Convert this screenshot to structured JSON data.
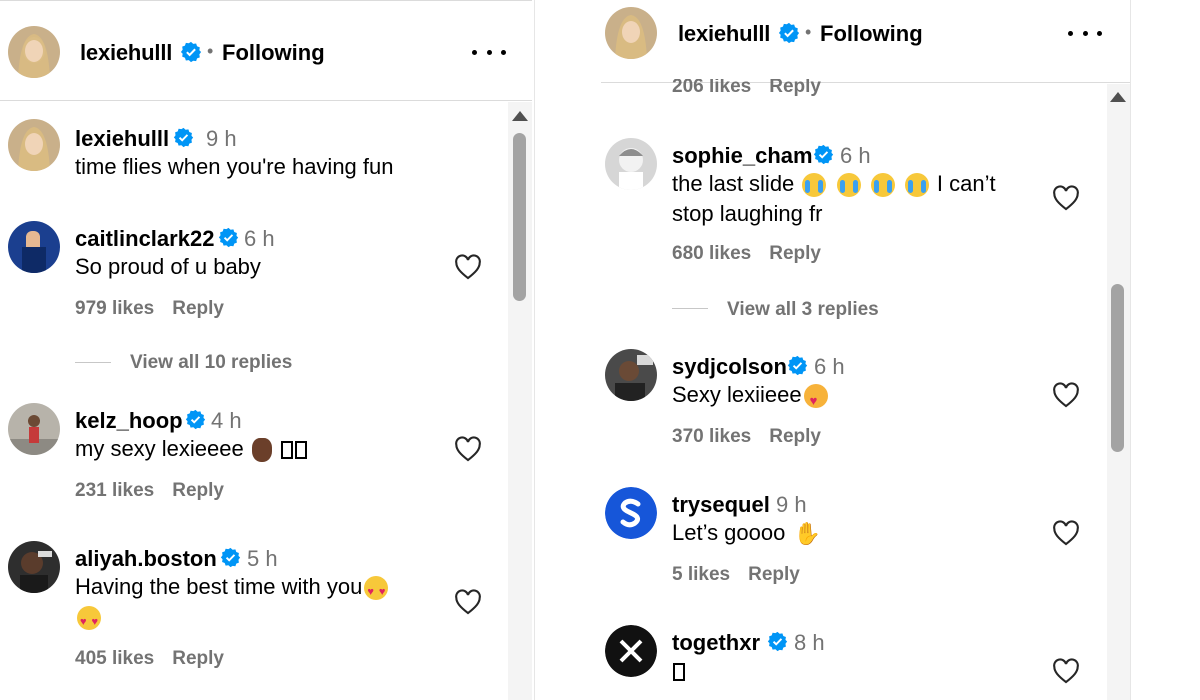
{
  "left": {
    "header": {
      "username": "lexiehulll",
      "separator": "•",
      "follow_status": "Following"
    },
    "caption": {
      "username": "lexiehulll",
      "time": "9 h",
      "text": "time flies when you're having fun"
    },
    "comments": [
      {
        "username": "caitlinclark22",
        "time": "6 h",
        "text": "So proud of u baby",
        "likes": "979 likes",
        "reply": "Reply"
      },
      {
        "username": "kelz_hoop",
        "time": "4 h",
        "text": "my sexy lexieeee",
        "likes": "231 likes",
        "reply": "Reply"
      },
      {
        "username": "aliyah.boston",
        "time": "5 h",
        "text": "Having the best time with you",
        "likes": "405 likes",
        "reply": "Reply"
      }
    ],
    "view_replies": "View all 10 replies"
  },
  "right": {
    "header": {
      "username": "lexiehulll",
      "separator": "•",
      "follow_status": "Following"
    },
    "partial_meta": {
      "likes": "206 likes",
      "reply": "Reply"
    },
    "comments": [
      {
        "username": "sophie_cham",
        "time": "6 h",
        "text_line1": "the last slide",
        "text_line1_tail": "I can’t",
        "text_line2": "stop laughing fr",
        "likes": "680 likes",
        "reply": "Reply"
      },
      {
        "username": "sydjcolson",
        "time": "6 h",
        "text": "Sexy lexiieee",
        "likes": "370 likes",
        "reply": "Reply"
      },
      {
        "username": "trysequel",
        "time": "9 h",
        "text": "Let’s goooo",
        "likes": "5 likes",
        "reply": "Reply"
      },
      {
        "username": "togethxr",
        "time": "8 h",
        "text": ""
      }
    ],
    "view_replies": "View all 3 replies"
  },
  "colors": {
    "verified": "#0095f6",
    "secondary_text": "#737373",
    "divider": "#dbdbdb",
    "scrollbar": "#a3a3a3"
  },
  "icons": [
    "verified-badge-icon",
    "more-options-icon",
    "heart-icon",
    "scroll-up-arrow-icon"
  ]
}
